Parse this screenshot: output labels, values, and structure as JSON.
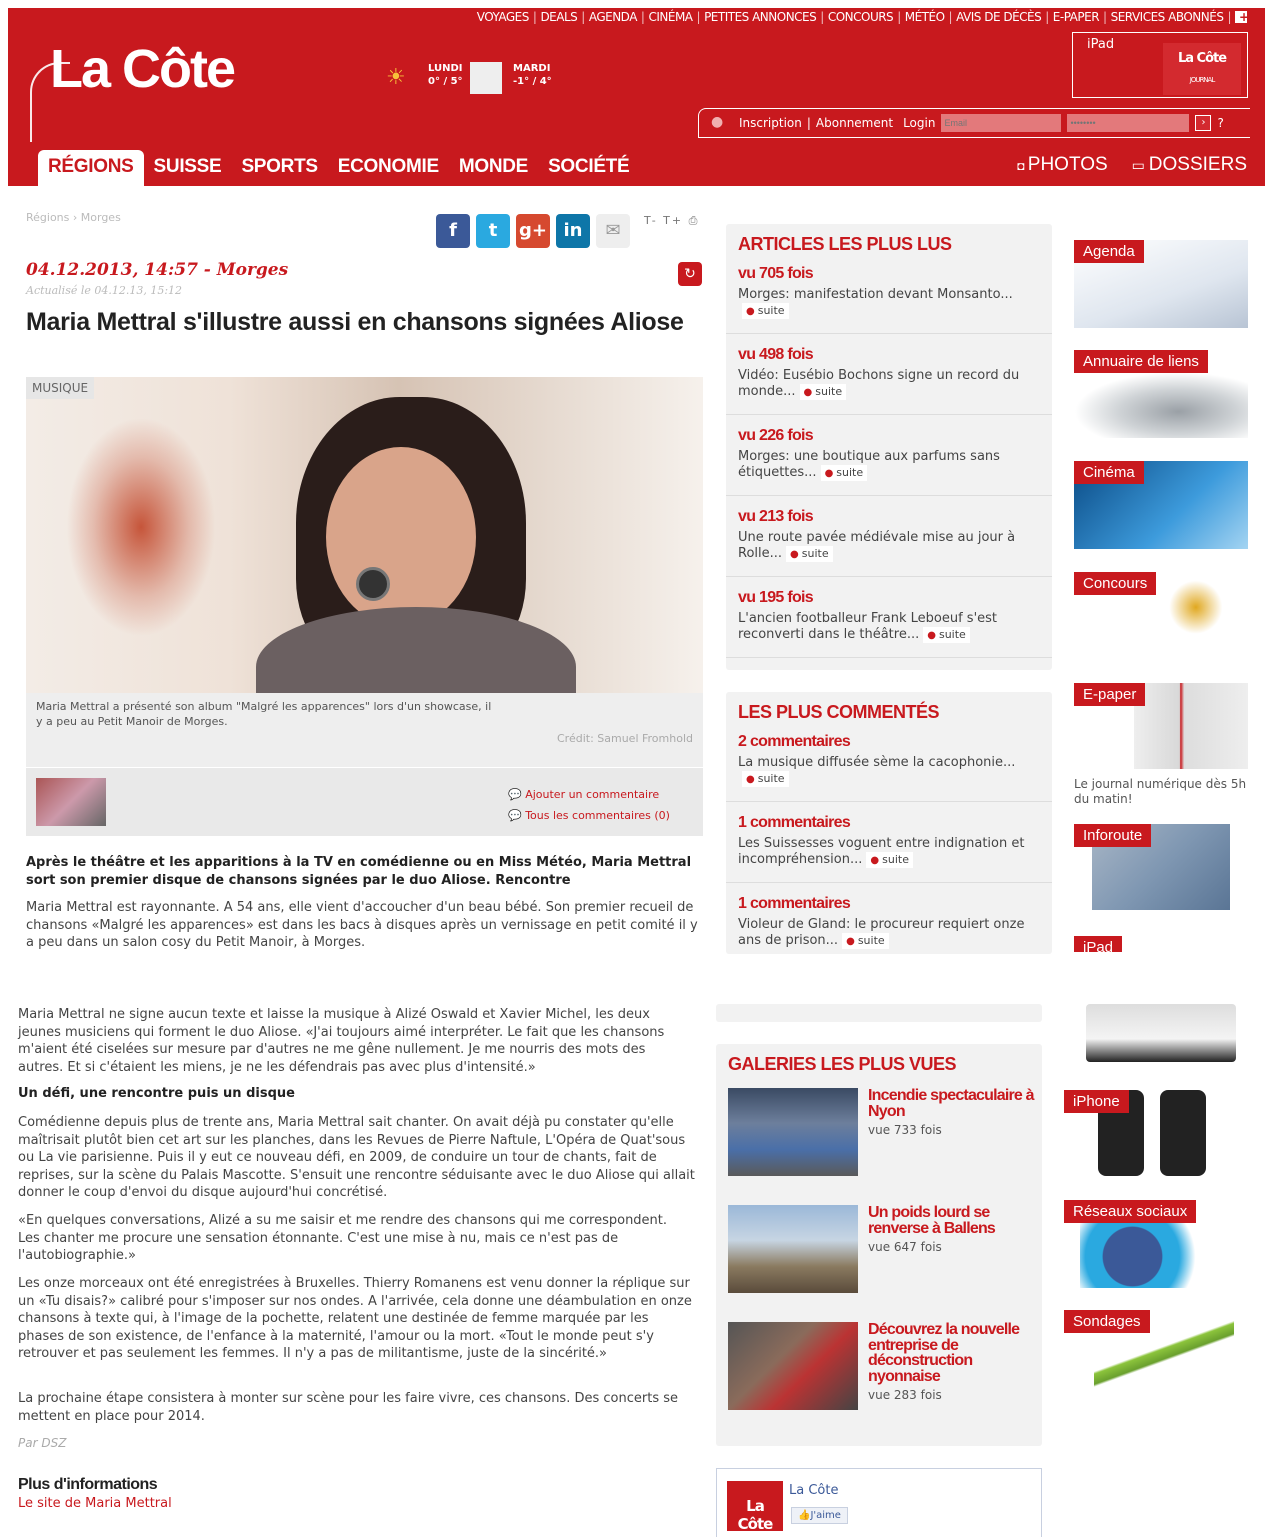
{
  "header": {
    "top_nav": [
      "VOYAGES",
      "DEALS",
      "AGENDA",
      "CINÉMA",
      "PETITES ANNONCES",
      "CONCOURS",
      "MÉTÉO",
      "AVIS DE DÉCÈS",
      "E-PAPER",
      "SERVICES ABONNÉS"
    ],
    "top_nav_plus": "+",
    "logo": "La Côte",
    "weather": [
      {
        "day": "LUNDI",
        "temp": "0° / 5°",
        "icon": "sun-cloud-icon"
      },
      {
        "day": "MARDI",
        "temp": "-1° / 4°",
        "icon": "cloud-icon"
      }
    ],
    "ipad_promo": {
      "label": "iPad",
      "mini_logo": "La Côte",
      "mini_sub": "JOURNAL"
    },
    "login": {
      "inscription": "Inscription",
      "separator": "|",
      "abonnement": "Abonnement",
      "login_label": "Login",
      "email_placeholder": "Email",
      "password_placeholder": "••••••••",
      "go": "›",
      "help": "?"
    },
    "main_nav": [
      "RÉGIONS",
      "SUISSE",
      "SPORTS",
      "ECONOMIE",
      "MONDE",
      "SOCIÉTÉ"
    ],
    "right_nav": [
      {
        "label": "PHOTOS",
        "icon": "camera-icon"
      },
      {
        "label": "DOSSIERS",
        "icon": "folder-icon"
      }
    ]
  },
  "article": {
    "breadcrumb": "Régions › Morges",
    "share": [
      "f",
      "t",
      "g+",
      "in",
      "✉"
    ],
    "text_tools": "T- T+ ⎙",
    "date": "04.12.2013, 14:57 - Morges",
    "updated": "Actualisé le 04.12.13, 15:12",
    "title": "Maria Mettral s'illustre aussi en chansons signées Aliose",
    "tag": "MUSIQUE",
    "caption": "Maria Mettral a présenté son album \"Malgré les apparences\" lors d'un showcase, il y a peu au Petit Manoir de Morges.",
    "credit": "Crédit: Samuel Fromhold",
    "add_comment": "Ajouter un commentaire",
    "all_comments": "Tous les commentaires (0)",
    "lead": "Après le théâtre et les apparitions à la TV en comédienne ou en Miss Météo, Maria Mettral sort son premier disque de chansons signées par le duo Aliose. Rencontre",
    "p1": "Maria Mettral est rayonnante. A 54 ans, elle vient d'accoucher d'un beau bébé. Son premier recueil de chansons «Malgré les apparences» est dans les bacs à disques après un vernissage en petit comité il y a peu dans un salon cosy du Petit Manoir, à Morges.",
    "p2": "Maria Mettral ne signe aucun texte et laisse la musique à Alizé Oswald et Xavier Michel, les deux jeunes musiciens qui forment le duo Aliose. «J'ai toujours aimé interpréter. Le fait que les chansons m'aient été ciselées sur mesure par d'autres ne me gêne nullement. Je me nourris des mots des autres. Et si c'étaient les miens, je ne les défendrais pas avec plus d'intensité.»",
    "subheading": "Un défi, une rencontre puis un disque",
    "p3": "Comédienne depuis plus de trente ans, Maria Mettral sait chanter. On avait déjà pu constater qu'elle maîtrisait plutôt bien cet art sur les planches, dans les Revues de Pierre Naftule, L'Opéra de Quat'sous ou La vie parisienne. Puis il y eut ce nouveau défi, en 2009, de conduire un tour de chants, fait de reprises, sur la scène du Palais Mascotte. S'ensuit une rencontre séduisante avec le duo Aliose qui allait donner le coup d'envoi du disque aujourd'hui concrétisé.",
    "p4": "«En quelques conversations, Alizé a su me saisir et me rendre des chansons qui me correspondent. Les chanter me procure une sensation étonnante. C'est une mise à nu, mais ce n'est pas de l'autobiographie.»",
    "p5": "Les onze morceaux ont été enregistrées à Bruxelles. Thierry Romanens est venu donner la réplique sur un «Tu disais?» calibré pour s'imposer sur nos ondes. A l'arrivée, cela donne une déambulation en onze chansons à texte qui, à l'image de la pochette, relatent une destinée de femme marquée par les phases de son existence, de l'enfance à la maternité, l'amour ou la mort. «Tout le monde peut s'y retrouver et pas seulement les femmes. Il n'y a pas de militantisme, juste de la sincérité.»",
    "p6": "La prochaine étape consistera à monter sur scène pour les faire vivre, ces chansons. Des concerts se mettent en place pour 2014.",
    "byline": "Par DSZ",
    "more_info": "Plus d'informations",
    "more_link": "Le site de Maria Mettral"
  },
  "most_read": {
    "title": "ARTICLES LES PLUS LUS",
    "items": [
      {
        "count": "vu 705 fois",
        "text": "Morges: manifestation devant Monsanto...",
        "more": "suite"
      },
      {
        "count": "vu 498 fois",
        "text": "Vidéo: Eusébio Bochons signe un record du monde...",
        "more": "suite"
      },
      {
        "count": "vu 226 fois",
        "text": "Morges: une boutique aux parfums sans étiquettes...",
        "more": "suite"
      },
      {
        "count": "vu 213 fois",
        "text": "Une route pavée médiévale mise au jour à Rolle...",
        "more": "suite"
      },
      {
        "count": "vu 195 fois",
        "text": "L'ancien footballeur Frank Leboeuf s'est reconverti dans le théâtre...",
        "more": "suite"
      }
    ]
  },
  "most_commented": {
    "title": "LES PLUS COMMENTÉS",
    "items": [
      {
        "count": "2 commentaires",
        "text": "La musique diffusée sème la cacophonie...",
        "more": "suite"
      },
      {
        "count": "1 commentaires",
        "text": "Les Suissesses voguent entre indignation et incompréhension...",
        "more": "suite"
      },
      {
        "count": "1 commentaires",
        "text": "Violeur de Gland: le procureur requiert onze ans de prison...",
        "more": "suite"
      }
    ]
  },
  "galleries": {
    "title": "GALERIES LES PLUS VUES",
    "items": [
      {
        "title": "Incendie spectaculaire à Nyon",
        "views": "vue 733 fois"
      },
      {
        "title": "Un poids lourd se renverse à Ballens",
        "views": "vue 647 fois"
      },
      {
        "title": "Découvrez la nouvelle entreprise de déconstruction nyonnaise",
        "views": "vue 283 fois"
      }
    ]
  },
  "widgets": [
    {
      "label": "Agenda"
    },
    {
      "label": "Annuaire de liens"
    },
    {
      "label": "Cinéma"
    },
    {
      "label": "Concours"
    },
    {
      "label": "E-paper",
      "caption": "Le journal numérique dès 5h du matin!"
    },
    {
      "label": "Inforoute"
    },
    {
      "label": "iPad"
    },
    {
      "label": "iPhone"
    },
    {
      "label": "Réseaux sociaux"
    },
    {
      "label": "Sondages"
    }
  ],
  "facebook": {
    "logo": "La Côte",
    "name": "La Côte",
    "like": "J'aime"
  },
  "colors": {
    "brand": "#c8191e",
    "facebook": "#3b5998",
    "twitter": "#2aa9e0",
    "google": "#d6492f",
    "linkedin": "#0e76a8"
  }
}
